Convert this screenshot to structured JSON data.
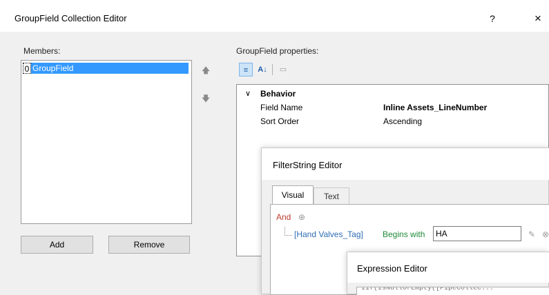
{
  "window": {
    "title": "GroupField Collection Editor",
    "help_glyph": "?",
    "close_glyph": "×"
  },
  "members": {
    "label": "Members:",
    "items": [
      {
        "index": "0",
        "name": "GroupField",
        "selected": true
      }
    ],
    "add_label": "Add",
    "remove_label": "Remove",
    "up_glyph": "🡅",
    "down_glyph": "🡇"
  },
  "properties": {
    "label": "GroupField properties:",
    "toolbar": {
      "categorized_icon": "≡",
      "alpha_icon": "A↓",
      "pages_icon": "▭"
    },
    "category": {
      "name": "Behavior",
      "toggle_glyph": "∨",
      "expanded": true
    },
    "rows": [
      {
        "name": "Field Name",
        "value": "Inline Assets_LineNumber"
      },
      {
        "name": "Sort Order",
        "value": "Ascending"
      }
    ]
  },
  "filter_editor": {
    "title": "FilterString Editor",
    "tabs": [
      {
        "label": "Visual",
        "active": true
      },
      {
        "label": "Text",
        "active": false
      }
    ],
    "group_operator": "And",
    "add_glyph": "⊕",
    "condition": {
      "field": "[Hand Valves_Tag]",
      "operator": "Begins with",
      "value": "HA",
      "edit_glyph": "✎",
      "remove_glyph": "⊗"
    }
  },
  "expression_editor": {
    "title": "Expression Editor",
    "text": "Iif(IsNullOrEmpty([PipeCollec..."
  },
  "colors": {
    "selection": "#3399ff",
    "and_operator": "#c0392b",
    "field_name": "#2e6db4",
    "operator": "#1e8a3a"
  }
}
